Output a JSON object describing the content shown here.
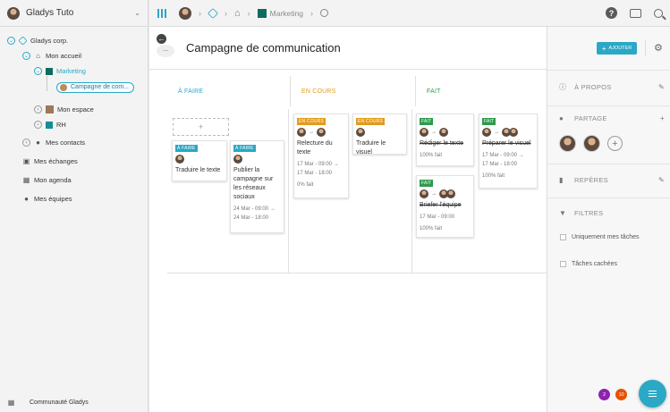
{
  "user": {
    "name": "Gladys Tuto"
  },
  "sidebar": {
    "org": "Gladys corp.",
    "home": "Mon accueil",
    "marketing": "Marketing",
    "campaign": "Campagne de com...",
    "space": "Mon espace",
    "rh": "RH",
    "contacts": "Mes contacts",
    "exchanges": "Mes échanges",
    "agenda": "Mon agenda",
    "teams": "Mes équipes",
    "footer": "Communauté Gladys"
  },
  "topbar": {
    "breadcrumb_current": "Marketing"
  },
  "page": {
    "title": "Campagne de communication",
    "add_label": "AJOUTER"
  },
  "columns": {
    "todo": "À FAIRE",
    "inprogress": "EN COURS",
    "done": "FAIT"
  },
  "badges": {
    "todo": "À FAIRE",
    "inprogress": "EN COURS",
    "done": "FAIT"
  },
  "cards": {
    "c1": {
      "title": "Traduire le texte"
    },
    "c2": {
      "title": "Publier la campagne sur les réseaux sociaux",
      "date1": "24 Mar - 09:00",
      "date2": "24 Mar - 18:00"
    },
    "c3": {
      "title": "Relecture du texte",
      "date1": "17 Mar - 09:00",
      "date2": "17 Mar - 18:00",
      "progress": "0% fait"
    },
    "c4": {
      "title": "Traduire le visuel"
    },
    "c5": {
      "title": "Rédiger le texte",
      "progress": "100% fait"
    },
    "c6": {
      "title": "Préparer le visuel",
      "date1": "17 Mar - 09:00",
      "date2": "17 Mar - 18:00",
      "progress": "100% fait"
    },
    "c7": {
      "title": "Briefer l'équipe",
      "date1": "17 Mar - 09:00",
      "progress": "100% fait"
    }
  },
  "right_panel": {
    "about": "À PROPOS",
    "share": "PARTAGE",
    "bookmarks": "REPÈRES",
    "filters": "FILTRES",
    "only_mine": "Uniquement mes tâches",
    "hidden": "Tâches cachées"
  },
  "counters": {
    "purple": "2",
    "orange": "10"
  },
  "colors": {
    "accent": "#2aa8c6",
    "todo": "#2aa8c6",
    "inprogress": "#e39b1b",
    "done": "#2e9b4e",
    "purple": "#8e24aa",
    "orange": "#e65100"
  }
}
